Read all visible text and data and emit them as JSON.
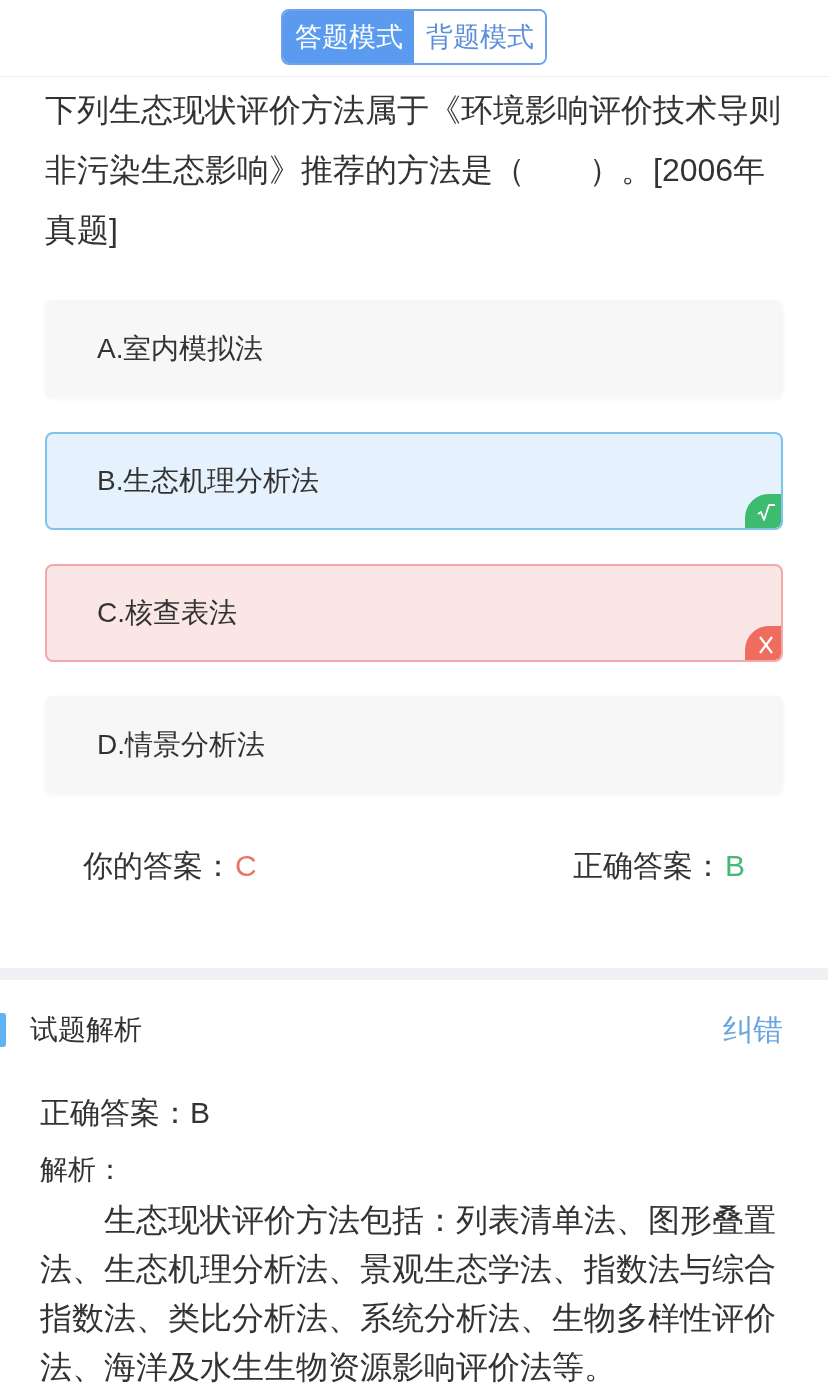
{
  "mode_switch": {
    "tabs": [
      {
        "label": "答题模式",
        "selected": true
      },
      {
        "label": "背题模式",
        "selected": false
      }
    ]
  },
  "question": {
    "text": "下列生态现状评价方法属于《环境影响评价技术导则非污染生态影响》推荐的方法是（　　）。[2006年真题]",
    "options": [
      {
        "label": "A.室内模拟法",
        "selected": false,
        "correct": false
      },
      {
        "label": "B.生态机理分析法",
        "selected": false,
        "correct": true
      },
      {
        "label": "C.核查表法",
        "selected": true,
        "correct": false
      },
      {
        "label": "D.情景分析法",
        "selected": false,
        "correct": false
      }
    ]
  },
  "answer_summary": {
    "your_answer_label": "你的答案：",
    "your_answer": "C",
    "correct_answer_label": "正确答案：",
    "correct_answer": "B"
  },
  "analysis": {
    "title": "试题解析",
    "report_link": "纠错",
    "correct_answer_line": "正确答案：B",
    "explanation_label": "解析：",
    "explanation": "生态现状评价方法包括：列表清单法、图形叠置法、生态机理分析法、景观生态学法、指数法与综合指数法、类比分析法、系统分析法、生物多样性评价法、海洋及水生生物资源影响评价法等。"
  }
}
